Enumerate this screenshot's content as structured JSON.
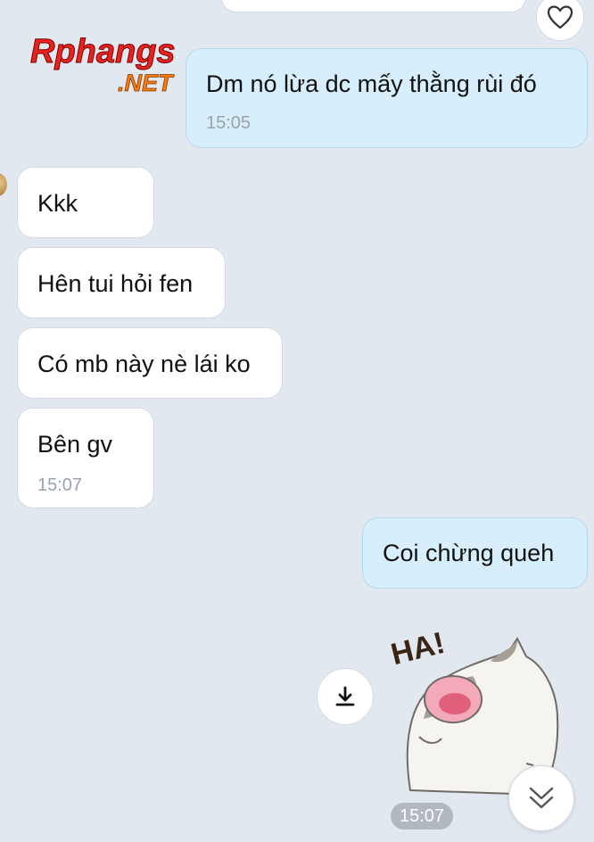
{
  "logo": {
    "main": "Rphangs",
    "sub": ".NET"
  },
  "messages": [
    {
      "text": "Dm nó lừa dc mấy thằng rùi đó",
      "time": "15:05"
    },
    {
      "text": "Kkk"
    },
    {
      "text": "Hên tui hỏi fen"
    },
    {
      "text": "Có mb này nè lái ko"
    },
    {
      "text": "Bên gv",
      "time": "15:07"
    },
    {
      "text": "Coi chừng queh"
    }
  ],
  "sticker": {
    "caption": "HA!",
    "time": "15:07"
  },
  "icons": {
    "heart": "heart-outline-icon",
    "download": "download-icon",
    "scroll_down": "double-chevron-down-icon"
  },
  "colors": {
    "background": "#e2e8f0",
    "incoming_bubble": "#ffffff",
    "outgoing_bubble": "#d7eefc",
    "timestamp": "#9aa2ab"
  }
}
